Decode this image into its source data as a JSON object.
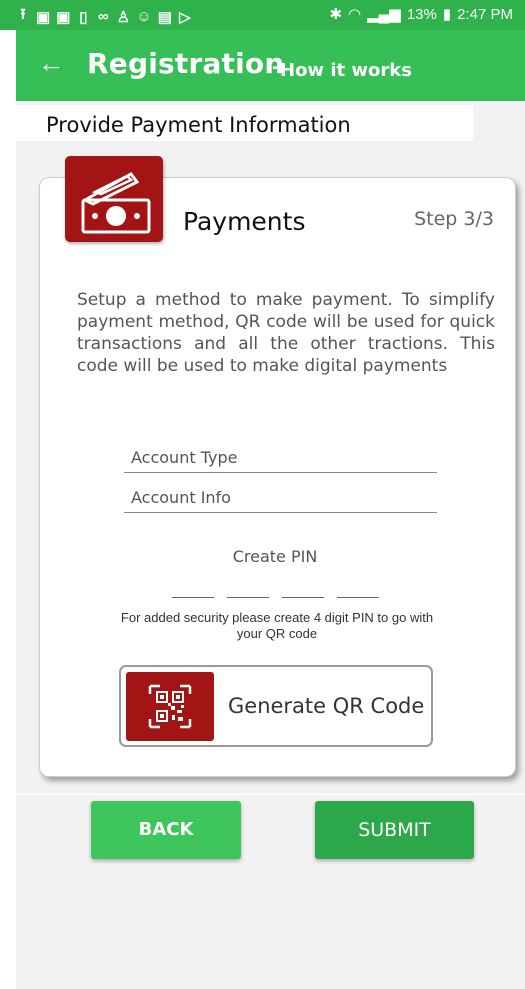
{
  "status_bar": {
    "icons": [
      "upload-icon",
      "youtube-icon",
      "youtube-icon",
      "sim-icon",
      "voicemail-icon",
      "amazon-music-icon",
      "smiley-icon",
      "mail-icon",
      "play-store-icon",
      "bluetooth-icon",
      "wifi-icon",
      "signal-icon"
    ],
    "battery": "13%",
    "time": "2:47 PM"
  },
  "app_bar": {
    "title": "Registration",
    "separator": "-",
    "subtitle": "How it works"
  },
  "sub_header": "Provide Payment Information",
  "card": {
    "title": "Payments",
    "step": "Step 3/3",
    "description": "Setup a method to make payment. To simplify payment method, QR code will be used for quick transactions and all the other tractions. This code will be used to make digital payments",
    "fields": {
      "account_type": "Account Type",
      "account_info": "Account Info"
    },
    "pin": {
      "label": "Create PIN",
      "help": "For added security please create 4 digit PIN to go with your QR code"
    },
    "qr_button": "Generate QR Code"
  },
  "buttons": {
    "back": "BACK",
    "submit": "SUBMIT"
  },
  "colors": {
    "status_bar": "#2fb24b",
    "app_bar": "#36bf57",
    "icon_red": "#a31515",
    "back_button": "#3ec55c",
    "submit_button": "#2ca84b"
  }
}
